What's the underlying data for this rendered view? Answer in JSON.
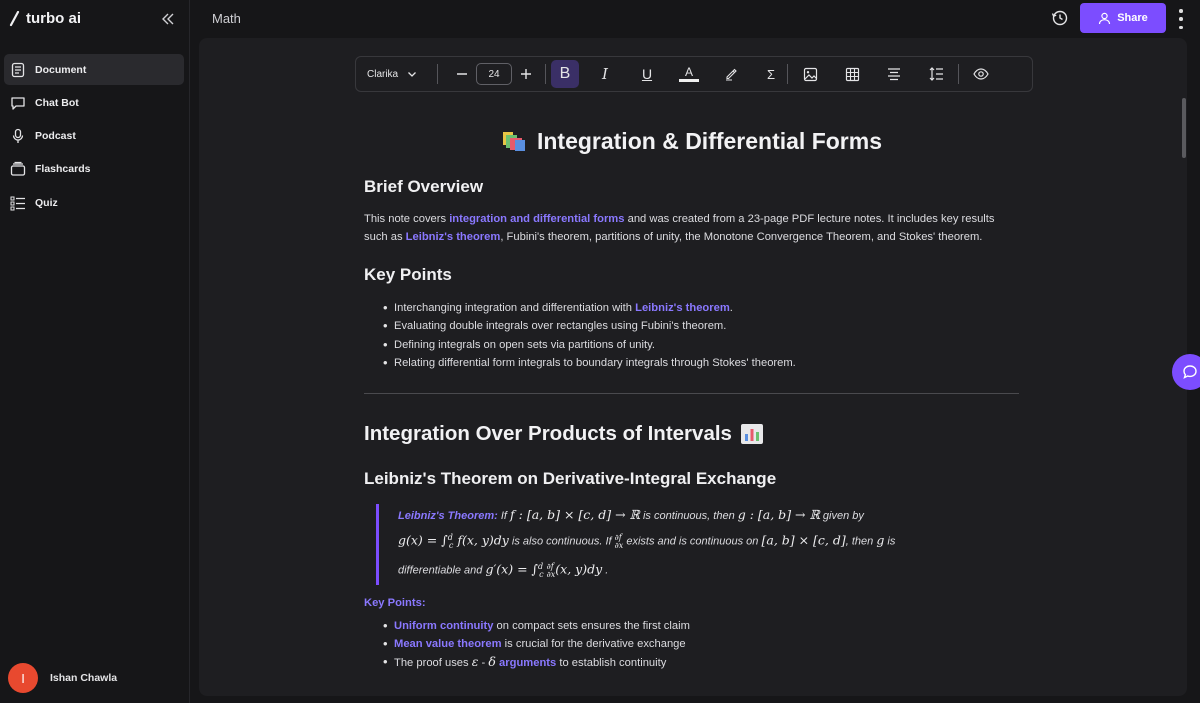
{
  "app": {
    "brand": "turbo ai"
  },
  "header": {
    "title": "Math",
    "share_label": "Share"
  },
  "sidebar": {
    "items": [
      {
        "label": "Document",
        "icon": "document-icon",
        "active": true
      },
      {
        "label": "Chat Bot",
        "icon": "chat-bubble-icon",
        "active": false
      },
      {
        "label": "Podcast",
        "icon": "microphone-icon",
        "active": false
      },
      {
        "label": "Flashcards",
        "icon": "cards-icon",
        "active": false
      },
      {
        "label": "Quiz",
        "icon": "list-checklist-icon",
        "active": false
      }
    ],
    "user": {
      "initial": "I",
      "name": "Ishan Chawla"
    }
  },
  "toolbar": {
    "font": "Clarika",
    "font_size": "24",
    "bold": "B",
    "italic": "I",
    "underline": "U",
    "text_color": "A",
    "sigma": "Σ"
  },
  "doc": {
    "title": "Integration & Differential Forms",
    "overview": {
      "heading": "Brief Overview",
      "text1": "This note covers ",
      "link1": "integration and differential forms",
      "text2": " and was created from a 23-page PDF lecture notes. It includes key results such as ",
      "link2": "Leibniz's theorem",
      "text3": ", Fubini's theorem, partitions of unity, the Monotone Convergence Theorem, and Stokes' theorem."
    },
    "key_points": {
      "heading": "Key Points",
      "item1_text": "Interchanging integration and differentiation with ",
      "item1_link": "Leibniz's theorem",
      "item1_end": ".",
      "item2": "Evaluating double integrals over rectangles using Fubini's theorem.",
      "item3": "Defining integrals on open sets via partitions of unity.",
      "item4": "Relating differential form integrals to boundary integrals through Stokes' theorem."
    },
    "section": {
      "heading": "Integration Over Products of Intervals",
      "subheading": "Leibniz's Theorem on Derivative-Integral Exchange",
      "quote": {
        "label": "Leibniz's Theorem:",
        "l1_a": " If ",
        "l1_f": "f : [a, b] × [c, d] → ℝ",
        "l1_b": " is continuous, then ",
        "l1_g": "g : [a, b] → ℝ",
        "l1_c": " given by",
        "l2_g": "g(x) = ∫",
        "l2_sup": "d",
        "l2_sub": "c",
        "l2_rest": " f(x, y)dy",
        "l2_a": " is also continuous. If ",
        "l2_frac_num": "∂f",
        "l2_frac_den": "∂x",
        "l2_b": " exists and is continuous on ",
        "l2_dom": "[a, b] × [c, d]",
        "l2_c": ", then ",
        "l2_gvar": "g",
        "l2_d": " is",
        "l3_a": "differentiable and ",
        "l3_eq": "g′(x) = ∫",
        "l3_sup": "d",
        "l3_sub": "c",
        "l3_frac_num": "∂f",
        "l3_frac_den": "∂x",
        "l3_rest": "(x, y)dy",
        "l3_end": " ."
      },
      "kp_label": "Key Points:",
      "kp1_link": "Uniform continuity",
      "kp1_text": " on compact sets ensures the first claim",
      "kp2_link": "Mean value theorem",
      "kp2_text": " is crucial for the derivative exchange",
      "kp3_text": "The proof uses ",
      "kp3_eps": "ε",
      "kp3_dash": " - ",
      "kp3_delta": "δ",
      "kp3_link": "arguments",
      "kp3_end": " to establish continuity"
    }
  },
  "colors": {
    "accent": "#7c4dff",
    "link": "#8a78ff",
    "background": "#161618",
    "panel": "#1e1e21",
    "avatar": "#e8492f"
  }
}
